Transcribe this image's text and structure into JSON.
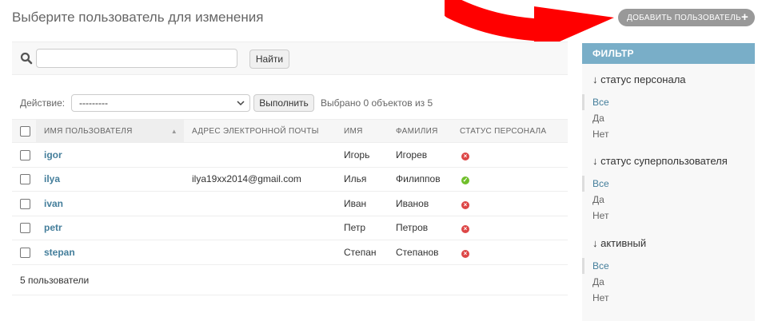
{
  "header": {
    "title": "Выберите пользователь для изменения",
    "add_button": "ДОБАВИТЬ ПОЛЬЗОВАТЕЛЬ",
    "add_icon": "+"
  },
  "search": {
    "value": "",
    "placeholder": "",
    "button": "Найти"
  },
  "actions": {
    "label": "Действие:",
    "selected": "---------",
    "go_button": "Выполнить",
    "selected_count": "Выбрано 0 объектов из 5"
  },
  "table": {
    "columns": [
      "ИМЯ ПОЛЬЗОВАТЕЛЯ",
      "АДРЕС ЭЛЕКТРОННОЙ ПОЧТЫ",
      "ИМЯ",
      "ФАМИЛИЯ",
      "СТАТУС ПЕРСОНАЛА"
    ],
    "rows": [
      {
        "username": "igor",
        "email": "",
        "first_name": "Игорь",
        "last_name": "Игорев",
        "staff": false
      },
      {
        "username": "ilya",
        "email": "ilya19xx2014@gmail.com",
        "first_name": "Илья",
        "last_name": "Филиппов",
        "staff": true
      },
      {
        "username": "ivan",
        "email": "",
        "first_name": "Иван",
        "last_name": "Иванов",
        "staff": false
      },
      {
        "username": "petr",
        "email": "",
        "first_name": "Петр",
        "last_name": "Петров",
        "staff": false
      },
      {
        "username": "stepan",
        "email": "",
        "first_name": "Степан",
        "last_name": "Степанов",
        "staff": false
      }
    ]
  },
  "paginator": "5 пользователи",
  "filter": {
    "title": "ФИЛЬТР",
    "groups": [
      {
        "title": "↓ статус персонала",
        "options": [
          "Все",
          "Да",
          "Нет"
        ]
      },
      {
        "title": "↓ статус суперпользователя",
        "options": [
          "Все",
          "Да",
          "Нет"
        ]
      },
      {
        "title": "↓ активный",
        "options": [
          "Все",
          "Да",
          "Нет"
        ]
      }
    ]
  },
  "colors": {
    "accent": "#79aec8",
    "link": "#447e9b",
    "annotation_arrow": "#ff0000",
    "status_yes": "#70bf2b",
    "status_no": "#dd4646"
  }
}
